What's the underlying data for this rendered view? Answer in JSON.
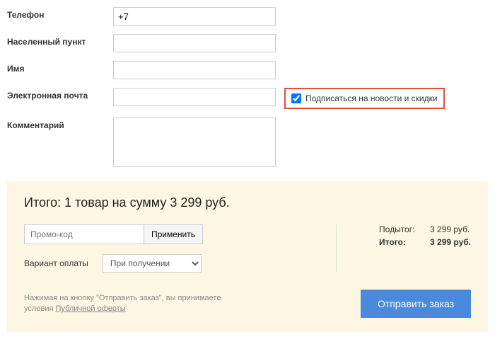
{
  "form": {
    "phone_label": "Телефон",
    "phone_value": "+7",
    "city_label": "Населенный пункт",
    "city_value": "",
    "name_label": "Имя",
    "name_value": "",
    "email_label": "Электронная почта",
    "email_value": "",
    "comment_label": "Комментарий",
    "comment_value": "",
    "subscribe_label": "Подписаться на новости и скидки",
    "subscribe_checked": true
  },
  "summary": {
    "title": "Итого: 1 товар на сумму 3 299 руб.",
    "promo_placeholder": "Промо-код",
    "promo_apply": "Применить",
    "payment_label": "Вариант оплаты",
    "payment_selected": "При получении",
    "subtotal_label": "Подытог:",
    "subtotal_value": "3 299 руб.",
    "total_label": "Итого:",
    "total_value": "3 299 руб.",
    "agree_prefix": "Нажимая на кнопку \"Отправить заказ\", вы принимаете условия ",
    "agree_link": "Публичной оферты",
    "submit": "Отправить заказ"
  }
}
